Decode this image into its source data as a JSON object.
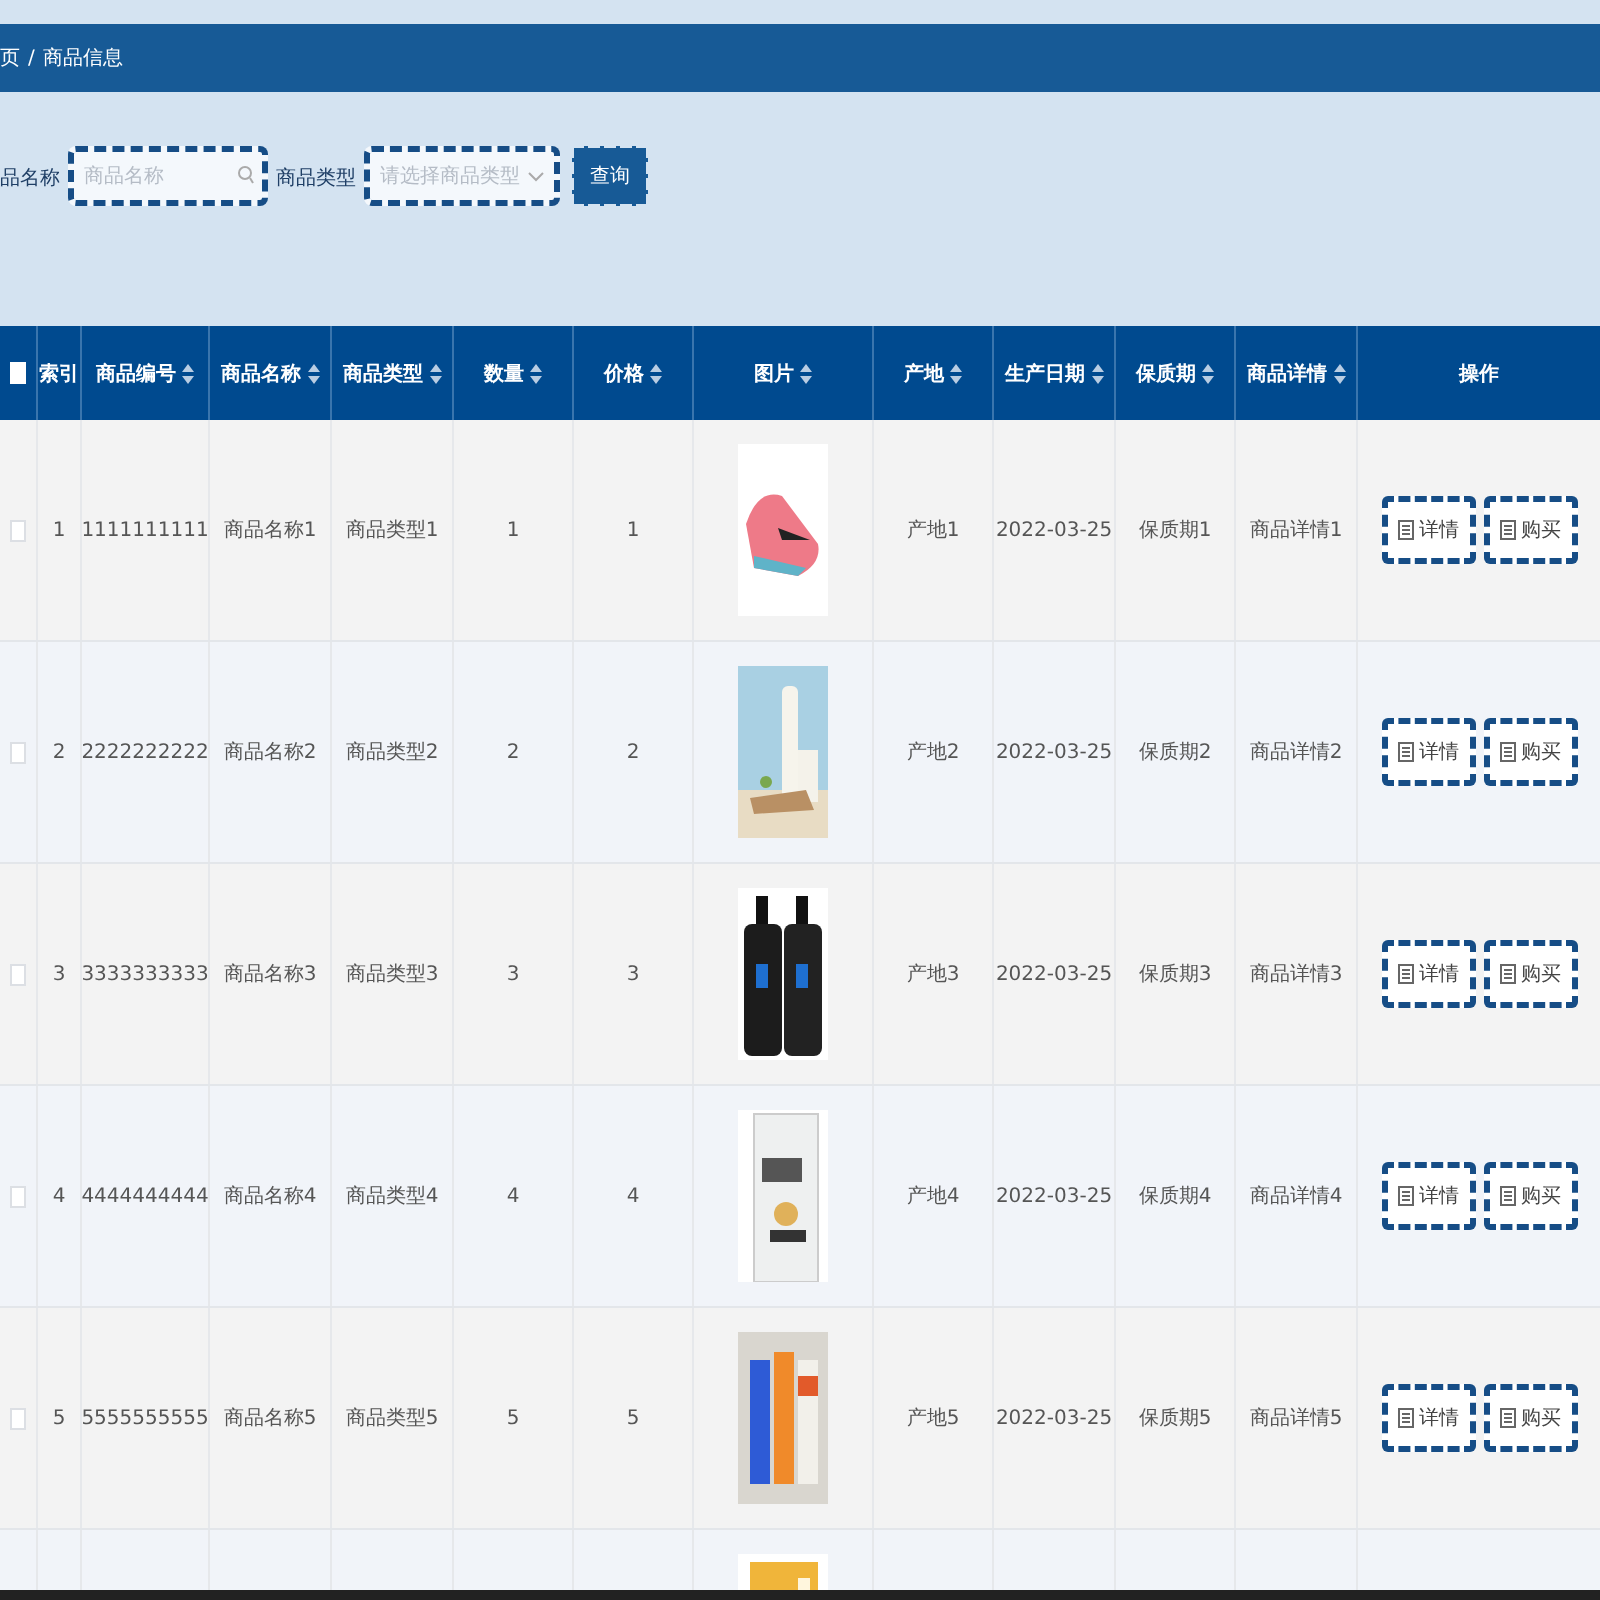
{
  "breadcrumb": {
    "items": [
      "页",
      "商品信息"
    ],
    "separator": "/"
  },
  "filters": {
    "name_label": "品名称",
    "name_field": {
      "placeholder": "商品名称"
    },
    "type_label": "商品类型",
    "type_select": {
      "placeholder": "请选择商品类型"
    },
    "query_button": "查询"
  },
  "table": {
    "select_all": {
      "checked": false
    },
    "columns": [
      {
        "label": "索引",
        "sortable": false
      },
      {
        "label": "商品编号",
        "sortable": true
      },
      {
        "label": "商品名称",
        "sortable": true
      },
      {
        "label": "商品类型",
        "sortable": true
      },
      {
        "label": "数量",
        "sortable": true
      },
      {
        "label": "价格",
        "sortable": true
      },
      {
        "label": "图片",
        "sortable": true
      },
      {
        "label": "产地",
        "sortable": true
      },
      {
        "label": "生产日期",
        "sortable": true
      },
      {
        "label": "保质期",
        "sortable": true
      },
      {
        "label": "商品详情",
        "sortable": true
      },
      {
        "label": "操作",
        "sortable": false
      }
    ],
    "rows": [
      {
        "checked": false,
        "cells": [
          "1",
          "1111111111",
          "商品名称1",
          "商品类型1",
          "1",
          "1"
        ],
        "cells_after": [
          "产地1",
          "2022-03-25",
          "保质期1",
          "商品详情1"
        ],
        "actions": [
          "详情",
          "购买"
        ]
      },
      {
        "checked": false,
        "cells": [
          "2",
          "2222222222",
          "商品名称2",
          "商品类型2",
          "2",
          "2"
        ],
        "cells_after": [
          "产地2",
          "2022-03-25",
          "保质期2",
          "商品详情2"
        ],
        "actions": [
          "详情",
          "购买"
        ]
      },
      {
        "checked": false,
        "cells": [
          "3",
          "3333333333",
          "商品名称3",
          "商品类型3",
          "3",
          "3"
        ],
        "cells_after": [
          "产地3",
          "2022-03-25",
          "保质期3",
          "商品详情3"
        ],
        "actions": [
          "详情",
          "购买"
        ]
      },
      {
        "checked": false,
        "cells": [
          "4",
          "4444444444",
          "商品名称4",
          "商品类型4",
          "4",
          "4"
        ],
        "cells_after": [
          "产地4",
          "2022-03-25",
          "保质期4",
          "商品详情4"
        ],
        "actions": [
          "详情",
          "购买"
        ]
      },
      {
        "checked": false,
        "cells": [
          "5",
          "5555555555",
          "商品名称5",
          "商品类型5",
          "5",
          "5"
        ],
        "cells_after": [
          "产地5",
          "2022-03-25",
          "保质期5",
          "商品详情5"
        ],
        "actions": [
          "详情",
          "购买"
        ]
      },
      {
        "cells": [],
        "cells_after": [],
        "actions": []
      }
    ]
  }
}
